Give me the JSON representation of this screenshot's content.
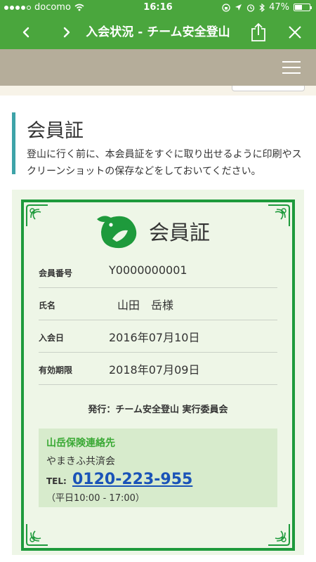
{
  "status": {
    "carrier": "docomo",
    "time": "16:16",
    "battery": "47%",
    "battery_level": 0.47
  },
  "nav": {
    "title": "入会状況 - チーム安全登山",
    "back_icon": "chevron-left-icon",
    "forward_icon": "chevron-right-icon",
    "share_icon": "share-icon",
    "close_icon": "close-icon"
  },
  "page": {
    "title": "会員証",
    "description": "登山に行く前に、本会員証をすぐに取り出せるように印刷やスクリーンショットの保存などをしておいてください。"
  },
  "card": {
    "title": "会員証",
    "rows": [
      {
        "label": "会員番号",
        "value": "Y0000000001"
      },
      {
        "label": "氏名",
        "value": "山田　岳様"
      },
      {
        "label": "入会日",
        "value": "2016年07月10日"
      },
      {
        "label": "有効期限",
        "value": "2018年07月09日"
      }
    ],
    "issuer": "発行：チーム安全登山 実行委員会"
  },
  "insurance": {
    "title": "山岳保険連絡先",
    "name": "やまきふ共済会",
    "tel_label": "TEL:",
    "tel": "0120-223-955",
    "hours": "（平日10:00 - 17:00）"
  },
  "colors": {
    "brand_green": "#4aa63d",
    "frame_green": "#1e9a3c",
    "accent_teal": "#3da3a8",
    "link_blue": "#1a53b8"
  }
}
